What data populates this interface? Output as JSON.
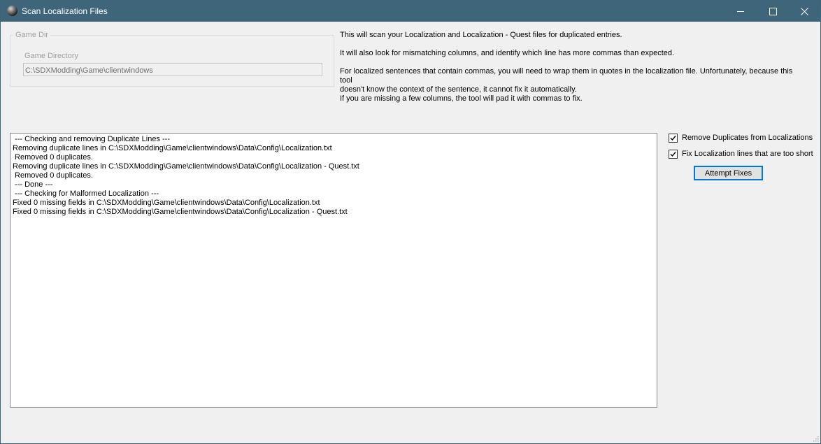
{
  "window": {
    "title": "Scan Localization Files"
  },
  "game_dir": {
    "group_label": "Game Dir",
    "field_label": "Game Directory",
    "value": "C:\\SDXModding\\Game\\clientwindows"
  },
  "description": {
    "line1": "This will scan your Localization and Localization - Quest files for duplicated entries.",
    "line2": "It will also look for mismatching columns, and identify which line has more commas than expected.",
    "line3a": "For localized sentences that contain commas, you will need to wrap them in quotes in the localization file. Unfortunately, because this tool",
    "line3b": "doesn't know the context of the sentence, it cannot fix it automatically.",
    "line4": "If you are missing a few columns, the tool will pad it with commas to fix."
  },
  "log": {
    "lines": [
      " --- Checking and removing Duplicate Lines ---",
      "Removing duplicate lines in C:\\SDXModding\\Game\\clientwindows\\Data\\Config\\Localization.txt",
      " Removed 0 duplicates.",
      "Removing duplicate lines in C:\\SDXModding\\Game\\clientwindows\\Data\\Config\\Localization - Quest.txt",
      " Removed 0 duplicates.",
      " --- Done ---",
      " --- Checking for Malformed Localization ---",
      "Fixed 0 missing fields in C:\\SDXModding\\Game\\clientwindows\\Data\\Config\\Localization.txt",
      "Fixed 0 missing fields in C:\\SDXModding\\Game\\clientwindows\\Data\\Config\\Localization - Quest.txt"
    ]
  },
  "options": {
    "remove_duplicates": {
      "label": "Remove Duplicates from Localizations",
      "checked": true
    },
    "fix_short_lines": {
      "label": "Fix Localization lines that are too short",
      "checked": true
    }
  },
  "actions": {
    "attempt_fixes_label": "Attempt Fixes"
  },
  "icons": {
    "app": "app-orb-icon",
    "minimize": "minimize-icon",
    "maximize": "maximize-icon",
    "close": "close-icon",
    "checkmark": "checkmark-icon",
    "resize_grip": "resize-grip-icon"
  },
  "colors": {
    "titlebar": "#3e6579",
    "window_bg": "#f0f0f0",
    "accent": "#0078d7",
    "disabled_text": "#a0a0a0"
  }
}
